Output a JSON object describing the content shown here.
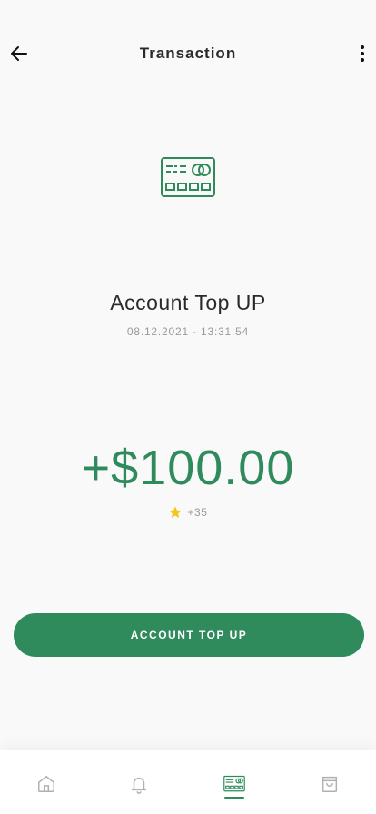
{
  "header": {
    "title": "Transaction",
    "back_icon": "arrow-left-icon",
    "more_icon": "more-vertical-icon"
  },
  "transaction": {
    "icon": "credit-card-icon",
    "name": "Account Top UP",
    "datetime": "08.12.2021 - 13:31:54",
    "amount": "+$100.00",
    "points_icon": "star-icon",
    "points": "+35"
  },
  "action": {
    "button_label": "ACCOUNT TOP UP"
  },
  "tabbar": {
    "items": [
      {
        "name": "home",
        "icon": "home-icon",
        "active": false
      },
      {
        "name": "notifications",
        "icon": "bell-icon",
        "active": false
      },
      {
        "name": "card",
        "icon": "credit-card-icon",
        "active": true
      },
      {
        "name": "shop",
        "icon": "shopping-bag-icon",
        "active": false
      }
    ]
  },
  "colors": {
    "accent": "#2f8a5c",
    "star": "#f5c518",
    "background": "#f9f9f9",
    "muted_text": "#9a9a9a",
    "inactive_icon": "#b0b0b0"
  }
}
